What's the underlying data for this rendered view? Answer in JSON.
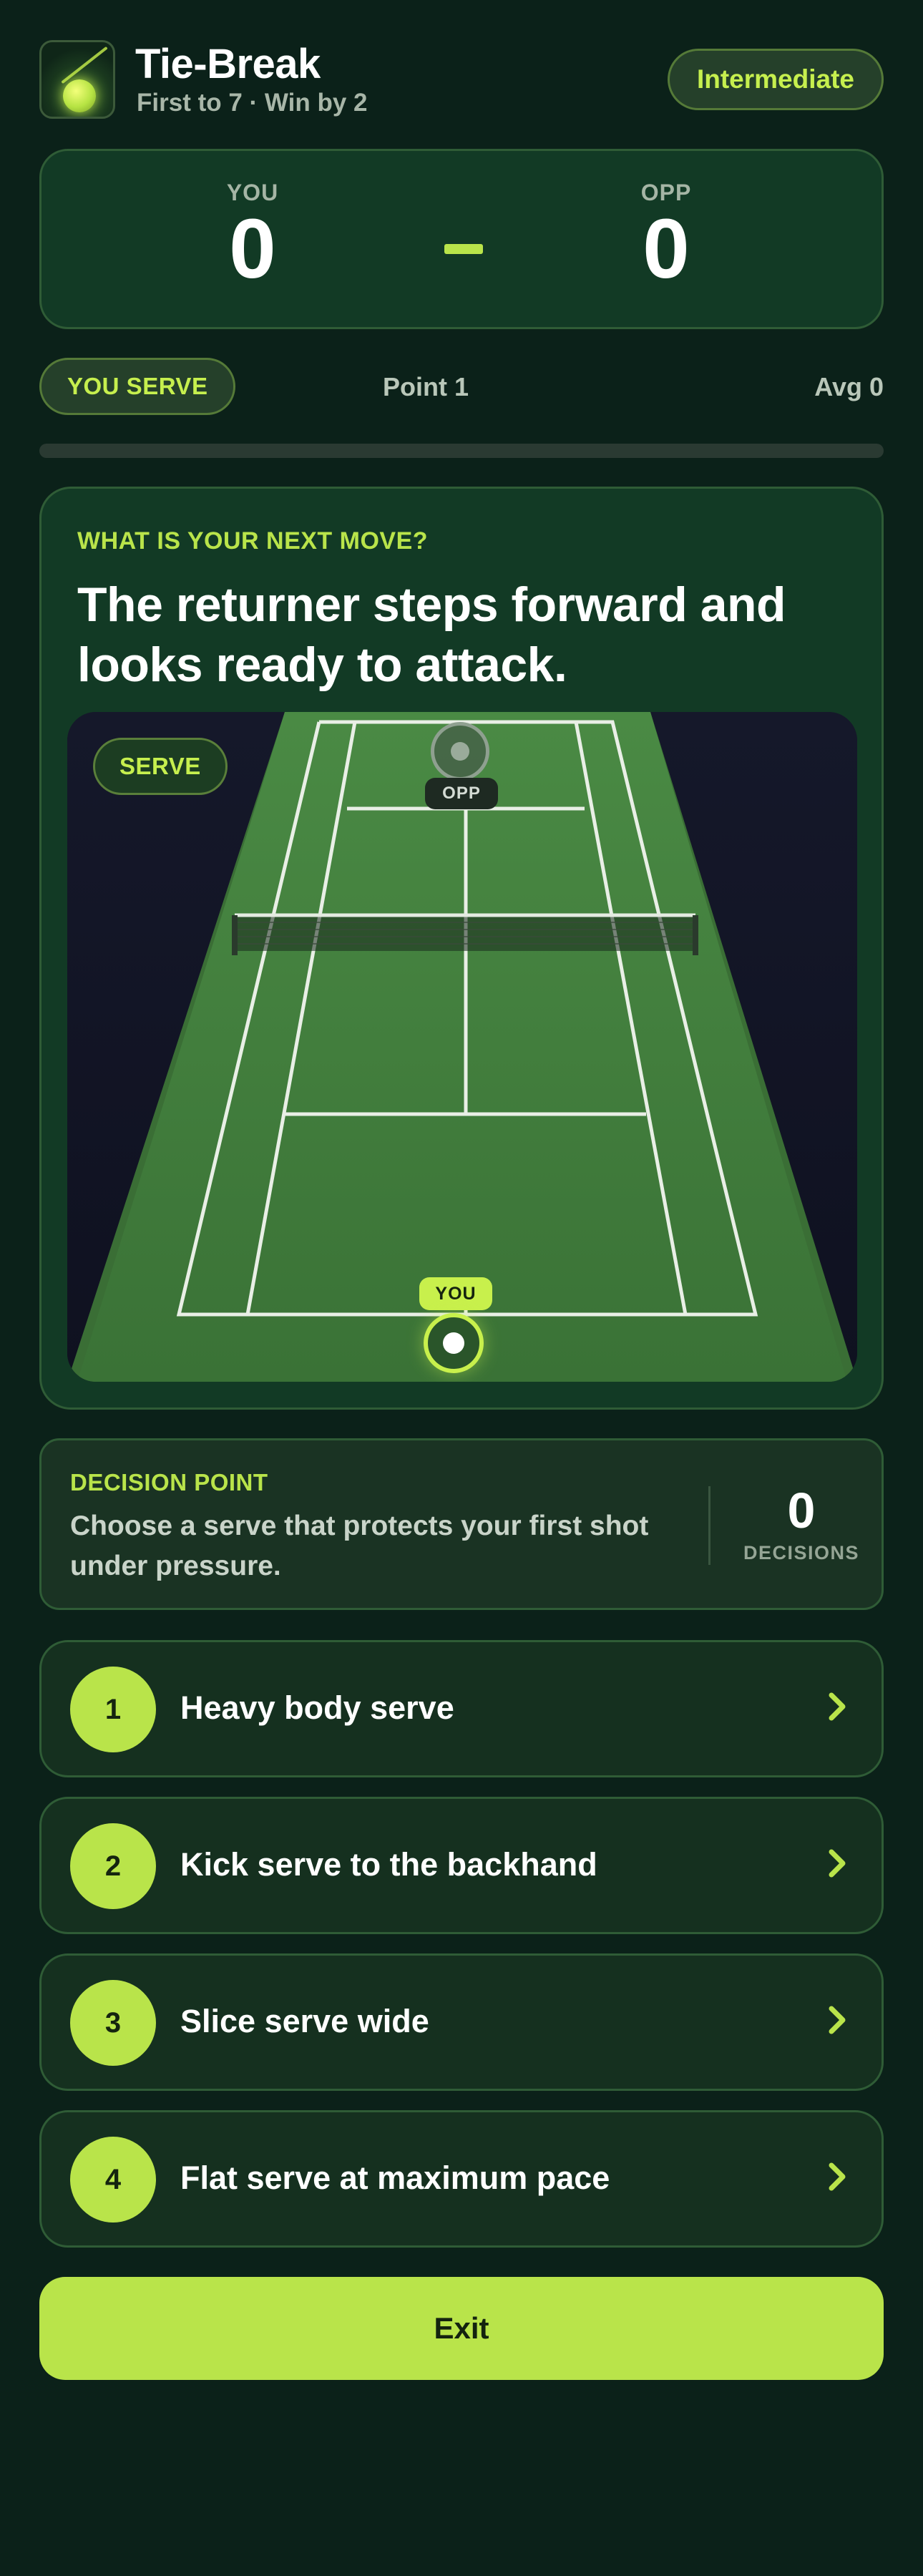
{
  "header": {
    "title": "Tie-Break",
    "subtitle": "First to 7 · Win by 2",
    "level": "Intermediate",
    "icon": "tennis-ball-logo-icon"
  },
  "score": {
    "you_label": "YOU",
    "you_value": "0",
    "opp_label": "OPP",
    "opp_value": "0"
  },
  "status": {
    "serve_label": "YOU SERVE",
    "point_label": "Point 1",
    "avg_label": "Avg 0",
    "progress": 0
  },
  "question": {
    "eyebrow": "WHAT IS YOUR NEXT MOVE?",
    "title": "The returner steps forward and looks ready to attack."
  },
  "court": {
    "phase_label": "SERVE",
    "opp_tag": "OPP",
    "you_tag": "YOU"
  },
  "decision": {
    "eyebrow": "DECISION POINT",
    "text": "Choose a serve that protects your first shot under pressure.",
    "count": "0",
    "count_label": "DECISIONS"
  },
  "options": [
    {
      "number": "1",
      "label": "Heavy body serve"
    },
    {
      "number": "2",
      "label": "Kick serve to the backhand"
    },
    {
      "number": "3",
      "label": "Slice serve wide"
    },
    {
      "number": "4",
      "label": "Flat serve at maximum pace"
    }
  ],
  "exit_label": "Exit",
  "colors": {
    "background": "#0b2119",
    "card": "#123a25",
    "accent": "#b9e44a",
    "court_green": "#3e7a3a"
  }
}
